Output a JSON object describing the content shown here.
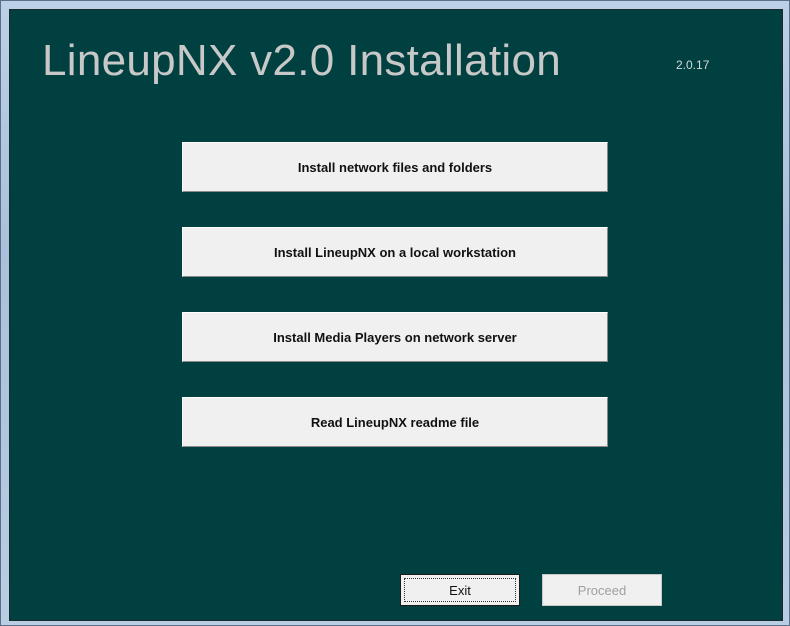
{
  "header": {
    "title": "LineupNX v2.0 Installation",
    "version": "2.0.17"
  },
  "actions": [
    {
      "label": "Install network files and folders"
    },
    {
      "label": "Install LineupNX on a local workstation"
    },
    {
      "label": "Install Media Players on network server"
    },
    {
      "label": "Read LineupNX readme file"
    }
  ],
  "footer": {
    "exit_label": "Exit",
    "proceed_label": "Proceed",
    "proceed_enabled": false
  },
  "colors": {
    "panel_background": "#004040",
    "title_text": "#c8c8c8",
    "button_face": "#f0f0f0",
    "disabled_text": "#a0a0a0"
  }
}
